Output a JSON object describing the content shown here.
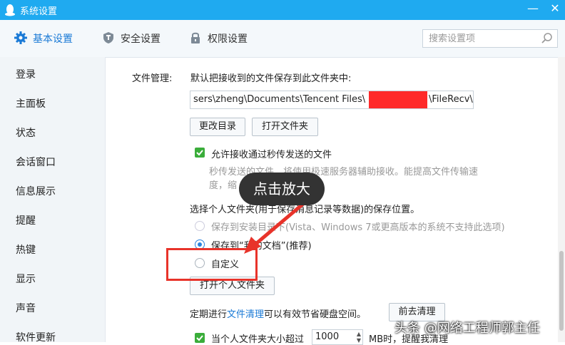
{
  "window": {
    "title": "系统设置",
    "minimize": "—",
    "close": "✕"
  },
  "tabs": [
    {
      "label": "基本设置",
      "icon": "gear-icon"
    },
    {
      "label": "安全设置",
      "icon": "shield-icon"
    },
    {
      "label": "权限设置",
      "icon": "lock-icon"
    }
  ],
  "search": {
    "placeholder": "搜索设置项"
  },
  "sidebar": {
    "items": [
      "登录",
      "主面板",
      "状态",
      "会话窗口",
      "信息展示",
      "提醒",
      "热键",
      "显示",
      "声音",
      "软件更新"
    ]
  },
  "file_management": {
    "label": "文件管理:",
    "desc": "默认把接收到的文件保存到此文件夹中:",
    "path_start": "sers\\zheng\\Documents\\Tencent Files\\",
    "path_end": "\\FileRecv\\",
    "change_dir_button": "更改目录",
    "open_folder_button": "打开文件夹",
    "allow_second_transfer": "允许接收通过秒传发送的文件",
    "second_transfer_desc1": "秒传发送的文件，将使用极速服务器辅助接收。能提高文件传输速",
    "second_transfer_desc2": "度，缩",
    "personal_folder_label": "选择个人文件夹(用于保存消息记录等数据)的保存位置。",
    "radio_install": "保存到安装目录下(Vista、Windows 7或更高版本的系统不支持此选项)",
    "radio_mydocs": "保存到“我的文档”(推荐)",
    "radio_custom": "自定义",
    "open_personal_button": "打开个人文件夹",
    "cleanup_prefix": "定期进行",
    "cleanup_link": "文件清理",
    "cleanup_suffix": "可以有效节省硬盘空间。",
    "cleanup_button": "前去清理",
    "size_prefix": "当个人文件夹大小超过",
    "size_value": "1000",
    "size_suffix": "MB时，提醒我清理"
  },
  "overlay": {
    "tooltip": "点击放大",
    "watermark": "头条 @网络工程师郭主任"
  }
}
